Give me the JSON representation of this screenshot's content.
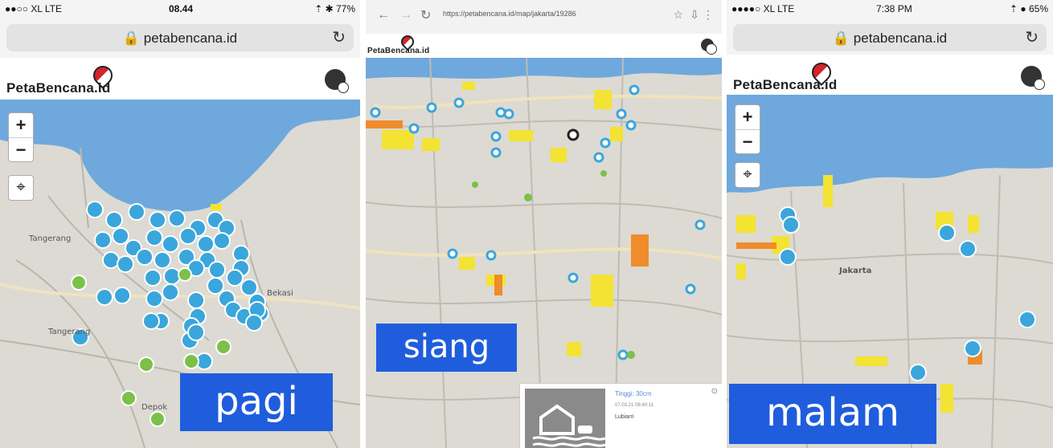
{
  "left_panel": {
    "status_carrier": "●●○○ XL LTE",
    "status_time": "08.44",
    "status_battery": "⇡ ✱ 77%",
    "url": "petabencana.id",
    "brand": "PetaBencana.id",
    "zoom_in": "+",
    "zoom_out": "−",
    "caption": "pagi",
    "labels": [
      "Tangerang",
      "Bekasi",
      "Depok",
      "Tangerang"
    ]
  },
  "middle_panel": {
    "url": "https://petabencana.id/map/jakarta/19286",
    "brand": "PetaBencana.id",
    "caption": "siang",
    "popup_title": "Tinggi: 30cm",
    "popup_sub": "07.03.21 08:40:11",
    "popup_text": "Lubiarri"
  },
  "right_panel": {
    "status_carrier": "●●●●○ XL LTE",
    "status_time": "7:38 PM",
    "status_battery": "⇡ ● 65%",
    "url": "petabencana.id",
    "brand": "PetaBencana.id",
    "zoom_in": "+",
    "zoom_out": "−",
    "caption": "malam",
    "labels": [
      "Jakarta"
    ]
  },
  "colors": {
    "sea": "#6fa8dc",
    "land": "#dcdad3",
    "flood_marker": "#3aa6dc",
    "caption_bg": "#1f5ddd",
    "warning_yellow": "#f3e332",
    "warning_orange": "#ef8c2b",
    "green_marker": "#7cc04a"
  }
}
